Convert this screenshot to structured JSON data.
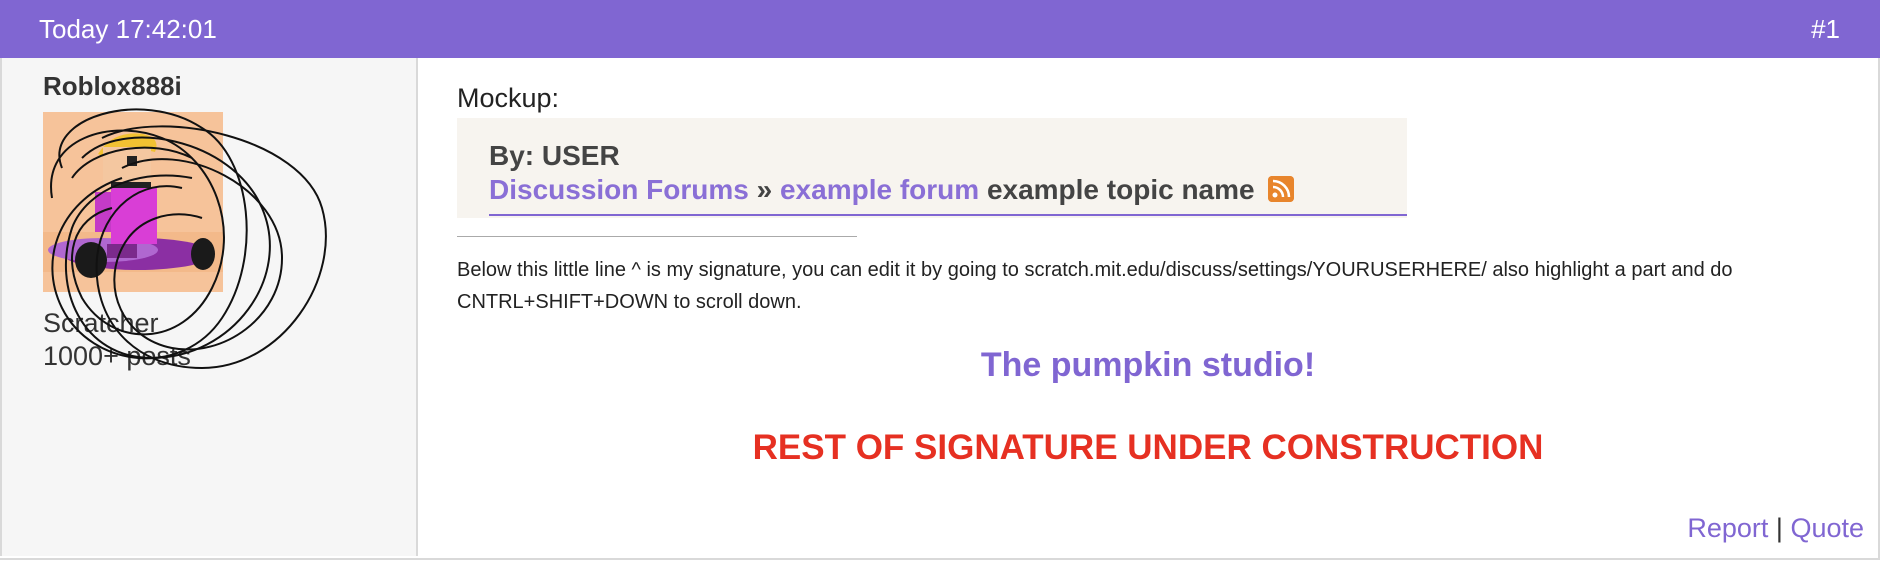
{
  "post": {
    "timestamp": "Today 17:42:01",
    "number": "#1"
  },
  "author": {
    "username": "Roblox888i",
    "rank": "Scratcher",
    "post_count": "1000+ posts"
  },
  "body": {
    "mockup_label": "Mockup:",
    "mockup": {
      "by": "By: USER",
      "crumb_forums": "Discussion Forums",
      "separator": "»",
      "crumb_forum": "example forum",
      "topic": "example topic name"
    },
    "signature_text": "Below this little line ^ is my signature, you can edit it by going to scratch.mit.edu/discuss/settings/YOURUSERHERE/ also highlight a part and do CNTRL+SHIFT+DOWN to scroll down.",
    "studio_link": "The pumpkin studio!",
    "construction": "REST OF SIGNATURE UNDER CONSTRUCTION"
  },
  "actions": {
    "report": "Report",
    "separator": "|",
    "quote": "Quote"
  },
  "colors": {
    "header": "#8066d2",
    "link": "#8066d2",
    "warning": "#e63022"
  },
  "icons": [
    "rss-icon",
    "avatar"
  ]
}
